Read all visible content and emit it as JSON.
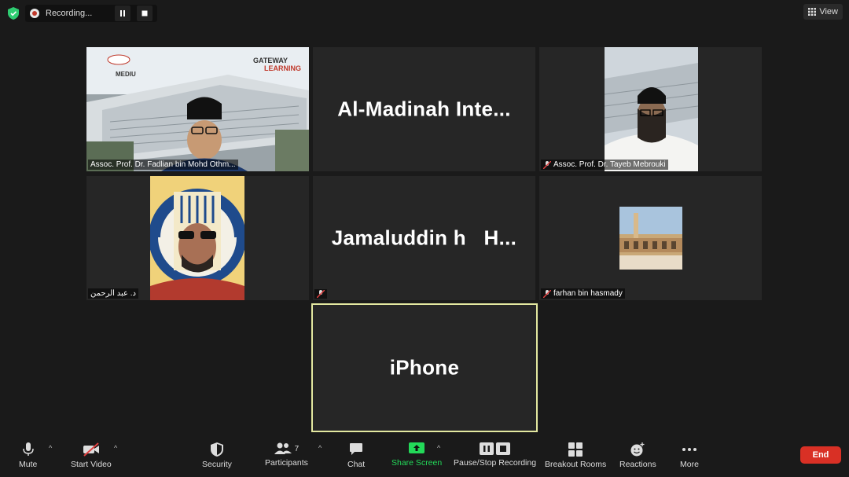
{
  "recording": {
    "label": "Recording..."
  },
  "view": {
    "label": "View"
  },
  "tiles": {
    "t1": {
      "name": "Assoc. Prof. Dr. Fadlian bin Mohd Othm...",
      "banner_brand": "MEDIU",
      "banner_tag_line1": "GATEWAY",
      "banner_tag_line2": "LEARNING"
    },
    "t2": {
      "big": "Al-Madinah  Inte..."
    },
    "t3": {
      "name": "Assoc. Prof. Dr. Tayeb Mebrouki"
    },
    "t4": {
      "name": "د. عبد الرحمن"
    },
    "t5": {
      "big": "Jamaluddin h   H..."
    },
    "t6": {
      "name": "farhan bin hasmady"
    },
    "t7": {
      "big": "iPhone"
    }
  },
  "toolbar": {
    "mute": "Mute",
    "start_video": "Start Video",
    "security": "Security",
    "participants": "Participants",
    "participants_count": "7",
    "chat": "Chat",
    "share_screen": "Share Screen",
    "pause_stop_recording": "Pause/Stop Recording",
    "breakout_rooms": "Breakout Rooms",
    "reactions": "Reactions",
    "more": "More",
    "end": "End"
  },
  "colors": {
    "share_green": "#23d959",
    "end_red": "#d93025",
    "active_speaker": "#e3e8a0",
    "shield_green": "#2ecc71"
  }
}
